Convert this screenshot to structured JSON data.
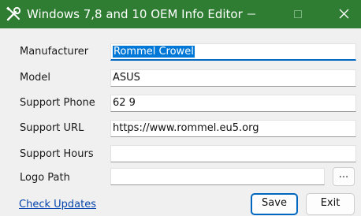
{
  "window": {
    "title": "Windows 7,8 and 10 OEM Info Editor",
    "icon": "tools-icon",
    "controls": [
      "minimize-icon",
      "maximize-icon",
      "close-icon"
    ]
  },
  "form": {
    "manufacturer": {
      "label": "Manufacturer",
      "value": "Rommel Crowel"
    },
    "model": {
      "label": "Model",
      "value": "ASUS"
    },
    "support_phone": {
      "label": "Support Phone",
      "value": "62 9"
    },
    "support_url": {
      "label": "Support URL",
      "value": "https://www.rommel.eu5.org"
    },
    "support_hours": {
      "label": "Support Hours",
      "value": ""
    },
    "logo_path": {
      "label": "Logo Path",
      "value": ""
    }
  },
  "buttons": {
    "browse": "...",
    "save": "Save",
    "exit": "Exit"
  },
  "links": {
    "check_updates": "Check Updates"
  },
  "colors": {
    "titlebar": "#2e7d32",
    "accent": "#0067c0",
    "selection": "#0078d7",
    "link": "#0645ad"
  }
}
